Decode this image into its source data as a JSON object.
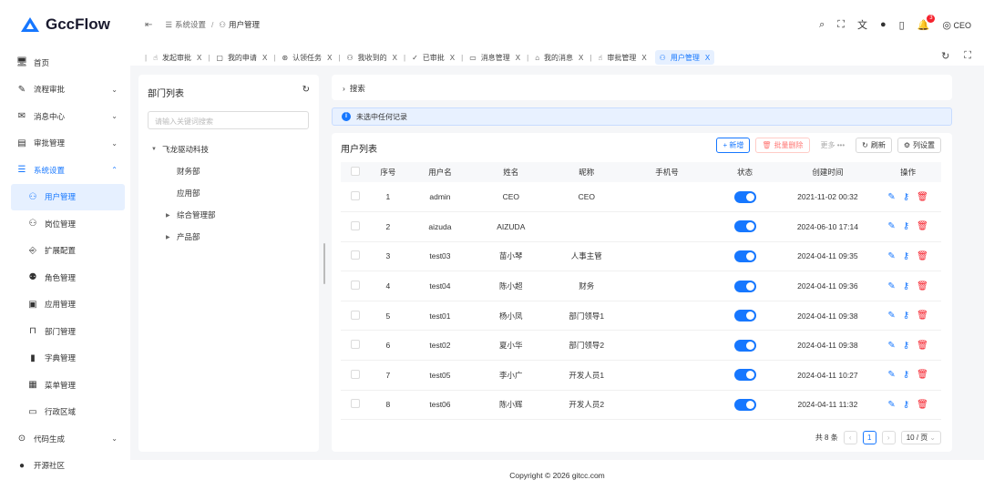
{
  "brand": {
    "name": "GccFlow",
    "color": "#1677ff"
  },
  "sidebar": {
    "items": [
      {
        "label": "首页",
        "icon": "monitor-icon"
      },
      {
        "label": "流程审批",
        "icon": "pen-icon"
      },
      {
        "label": "消息中心",
        "icon": "mail-icon"
      },
      {
        "label": "审批管理",
        "icon": "document-icon"
      },
      {
        "label": "系统设置",
        "icon": "settings-icon"
      },
      {
        "label": "用户管理",
        "icon": "user-icon"
      },
      {
        "label": "岗位管理",
        "icon": "user-gear-icon"
      },
      {
        "label": "扩展配置",
        "icon": "extension-icon"
      },
      {
        "label": "角色管理",
        "icon": "team-icon"
      },
      {
        "label": "应用管理",
        "icon": "app-icon"
      },
      {
        "label": "部门管理",
        "icon": "department-icon"
      },
      {
        "label": "字典管理",
        "icon": "dictionary-icon"
      },
      {
        "label": "菜单管理",
        "icon": "menu-grid-icon"
      },
      {
        "label": "行政区域",
        "icon": "region-icon"
      },
      {
        "label": "代码生成",
        "icon": "code-icon"
      },
      {
        "label": "开源社区",
        "icon": "github-icon"
      }
    ]
  },
  "breadcrumb": {
    "parent": "系统设置",
    "sep": "/",
    "current": "用户管理"
  },
  "header": {
    "notification_count": "3",
    "user": "CEO"
  },
  "tabs": [
    {
      "label": "发起审批"
    },
    {
      "label": "我的申请"
    },
    {
      "label": "认领任务"
    },
    {
      "label": "我收到的"
    },
    {
      "label": "已审批"
    },
    {
      "label": "消息管理"
    },
    {
      "label": "我的消息"
    },
    {
      "label": "审批管理"
    },
    {
      "label": "用户管理"
    }
  ],
  "tab_close": "X",
  "dept": {
    "title": "部门列表",
    "search_placeholder": "请输入关键词搜索",
    "tree": [
      {
        "label": "飞龙驱动科技",
        "level": 0,
        "arrow": "▼"
      },
      {
        "label": "财务部",
        "level": 1,
        "arrow": ""
      },
      {
        "label": "应用部",
        "level": 1,
        "arrow": ""
      },
      {
        "label": "综合管理部",
        "level": 1,
        "arrow": "▶"
      },
      {
        "label": "产品部",
        "level": 1,
        "arrow": "▶"
      }
    ]
  },
  "search": {
    "label": "搜索"
  },
  "alert": {
    "text": "未选中任何记录"
  },
  "users": {
    "title": "用户列表",
    "buttons": {
      "add": "+ 新增",
      "batch_delete": "批量删除",
      "more": "更多 •••",
      "refresh": "刷新",
      "columns": "列设置"
    },
    "columns": [
      "序号",
      "用户名",
      "姓名",
      "昵称",
      "手机号",
      "状态",
      "创建时间",
      "操作"
    ],
    "rows": [
      {
        "no": "1",
        "username": "admin",
        "name": "CEO",
        "nickname": "CEO",
        "phone": "",
        "enabled": true,
        "created": "2021-11-02 00:32"
      },
      {
        "no": "2",
        "username": "aizuda",
        "name": "AIZUDA",
        "nickname": "",
        "phone": "",
        "enabled": true,
        "created": "2024-06-10 17:14"
      },
      {
        "no": "3",
        "username": "test03",
        "name": "苗小琴",
        "nickname": "人事主管",
        "phone": "",
        "enabled": true,
        "created": "2024-04-11 09:35"
      },
      {
        "no": "4",
        "username": "test04",
        "name": "陈小超",
        "nickname": "财务",
        "phone": "",
        "enabled": true,
        "created": "2024-04-11 09:36"
      },
      {
        "no": "5",
        "username": "test01",
        "name": "杨小凤",
        "nickname": "部门领导1",
        "phone": "",
        "enabled": true,
        "created": "2024-04-11 09:38"
      },
      {
        "no": "6",
        "username": "test02",
        "name": "夏小华",
        "nickname": "部门领导2",
        "phone": "",
        "enabled": true,
        "created": "2024-04-11 09:38"
      },
      {
        "no": "7",
        "username": "test05",
        "name": "李小广",
        "nickname": "开发人员1",
        "phone": "",
        "enabled": true,
        "created": "2024-04-11 10:27"
      },
      {
        "no": "8",
        "username": "test06",
        "name": "陈小辉",
        "nickname": "开发人员2",
        "phone": "",
        "enabled": true,
        "created": "2024-04-11 11:32"
      }
    ]
  },
  "pagination": {
    "total": "共 8 条",
    "current": "1",
    "page_size": "10 / 页"
  },
  "footer": {
    "copyright": "Copyright © 2026 gitcc.com"
  }
}
